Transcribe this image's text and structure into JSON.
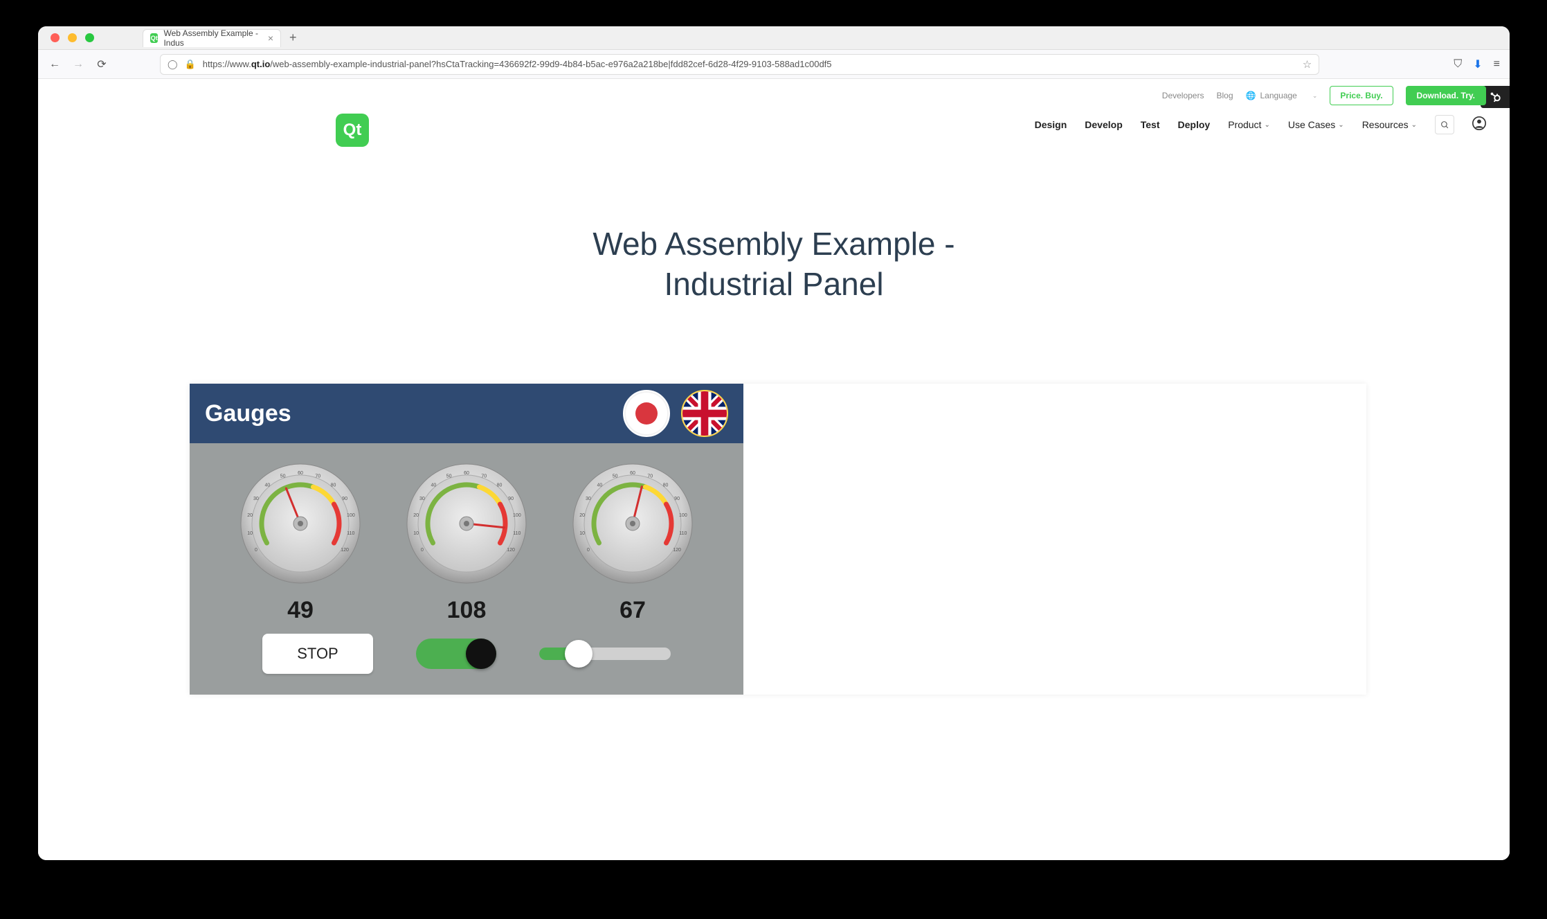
{
  "browser": {
    "tab_title": "Web Assembly Example - Indus",
    "url_prefix": "https://www.",
    "url_domain": "qt.io",
    "url_path": "/web-assembly-example-industrial-panel?hsCtaTracking=436692f2-99d9-4b84-b5ac-e976a2a218be|fdd82cef-6d28-4f29-9103-588ad1c00df5"
  },
  "topstrip": {
    "developers": "Developers",
    "blog": "Blog",
    "language": "Language",
    "price_buy": "Price. Buy.",
    "download_try": "Download. Try."
  },
  "mainnav": {
    "design": "Design",
    "develop": "Develop",
    "test": "Test",
    "deploy": "Deploy",
    "product": "Product",
    "usecases": "Use Cases",
    "resources": "Resources"
  },
  "logo_text": "Qt",
  "page_title_line1": "Web Assembly Example -",
  "page_title_line2": "Industrial Panel",
  "panel": {
    "header": "Gauges",
    "gauge1_value": "49",
    "gauge2_value": "108",
    "gauge3_value": "67",
    "stop_label": "STOP",
    "slider_percent": 30,
    "gauge_labels": {
      "min": "0",
      "max": "120",
      "l10": "10",
      "l20": "20",
      "l30": "30",
      "l40": "40",
      "l50": "50",
      "l60": "60",
      "l70": "70",
      "l80": "80",
      "l90": "90",
      "l100": "100",
      "l110": "110"
    }
  }
}
